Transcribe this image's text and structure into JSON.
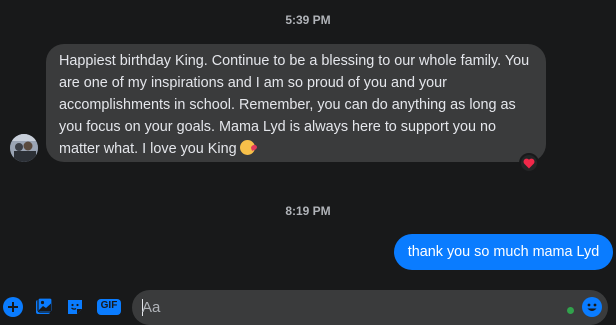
{
  "thread": {
    "timestamp_1": "5:39 PM",
    "timestamp_2": "8:19 PM",
    "incoming_message": {
      "text": "Happiest birthday King. Continue to be a blessing to our whole family. You are one of my inspirations and I am so proud of you and your accomplishments in school. Remember, you can do anything as long as you focus on your goals. Mama Lyd is always here to support you no matter what. I love you King",
      "emoji": "kissing-face-emoji",
      "reaction": "heart"
    },
    "outgoing_message": {
      "text": "thank you so much mama Lyd"
    }
  },
  "composer": {
    "placeholder": "Aa",
    "tools": [
      "plus-icon",
      "image-icon",
      "sticker-icon",
      "gif-icon"
    ],
    "gif_label": "GIF",
    "emoji_button": "smile-icon"
  },
  "colors": {
    "background": "#18191a",
    "incoming_bubble": "#3a3b3c",
    "outgoing_bubble": "#0a7cff",
    "accent": "#0a7cff",
    "online": "#31a24c"
  }
}
